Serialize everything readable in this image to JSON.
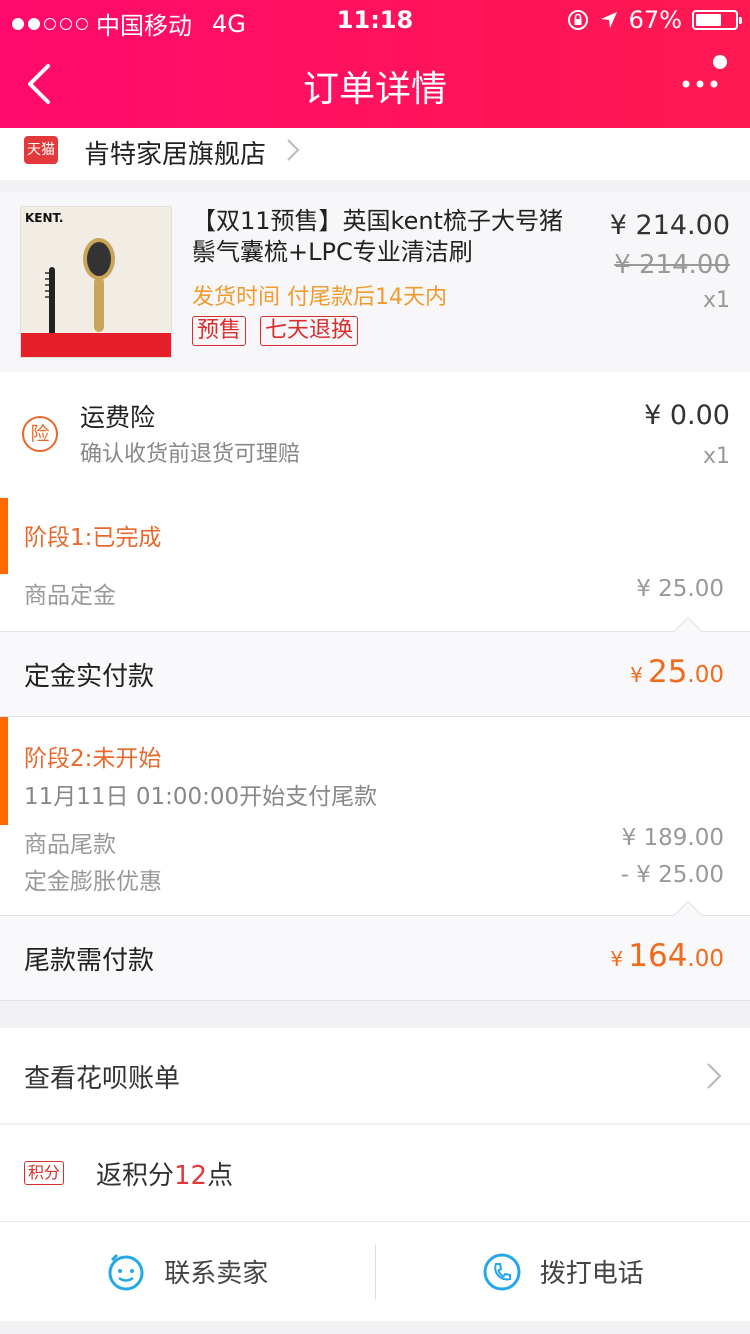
{
  "status": {
    "carrier": "中国移动",
    "network": "4G",
    "time": "11:18",
    "battery": "67%",
    "battery_level": 0.67
  },
  "nav": {
    "title": "订单详情"
  },
  "shop": {
    "badge": "天猫",
    "name": "肯特家居旗舰店"
  },
  "product": {
    "thumb_logo": "KENT.",
    "title": "【双11预售】英国kent梳子大号猪鬃气囊梳+LPC专业清洁刷",
    "shipping": "发货时间 付尾款后14天内",
    "tags": [
      "预售",
      "七天退换"
    ],
    "price": "¥ 214.00",
    "original_price": "¥ 214.00",
    "qty": "x1"
  },
  "insurance": {
    "icon_text": "险",
    "title": "运费险",
    "subtitle": "确认收货前退货可理赔",
    "price": "¥ 0.00",
    "qty": "x1"
  },
  "stage1": {
    "title": "阶段1:已完成",
    "rows": [
      {
        "label": "商品定金",
        "value": "¥ 25.00"
      }
    ],
    "pay_label": "定金实付款",
    "pay_currency": "¥",
    "pay_int": "25",
    "pay_dec": ".00"
  },
  "stage2": {
    "title": "阶段2:未开始",
    "subtitle": "11月11日 01:00:00开始支付尾款",
    "rows": [
      {
        "label": "商品尾款",
        "value": "¥ 189.00"
      },
      {
        "label": "定金膨胀优惠",
        "value": "- ¥ 25.00"
      }
    ],
    "pay_label": "尾款需付款",
    "pay_currency": "¥",
    "pay_int": "164",
    "pay_dec": ".00"
  },
  "bill": {
    "label": "查看花呗账单"
  },
  "points": {
    "tag": "积分",
    "prefix": "返积分",
    "num": "12",
    "suffix": "点"
  },
  "actions": {
    "contact": "联系卖家",
    "call": "拨打电话"
  },
  "colors": {
    "brand": "#ff1160",
    "accent": "#f26a1b",
    "stage_bar": "#ff6a00",
    "tag_red": "#d72e2e"
  }
}
